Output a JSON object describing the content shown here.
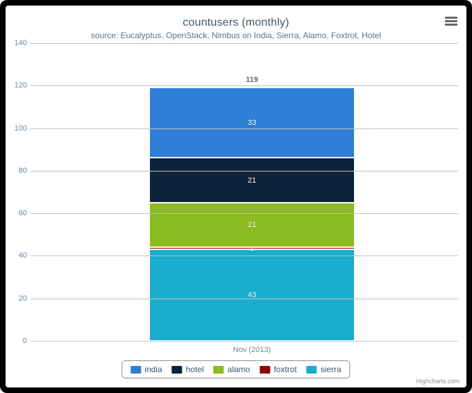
{
  "chart": {
    "title": "countusers (monthly)",
    "subtitle": "source: Eucalyptus, OpenStack, Nimbus on India, Sierra, Alamo, Foxtrot, Hotel",
    "credits": "Highcharts.com",
    "context_menu_icon": "hamburger-icon"
  },
  "chart_data": {
    "type": "bar",
    "stacked": true,
    "title": "countusers (monthly)",
    "subtitle": "source: Eucalyptus, OpenStack, Nimbus on India, Sierra, Alamo, Foxtrot, Hotel",
    "xlabel": "",
    "ylabel": "",
    "categories": [
      "Nov (2013)"
    ],
    "ylim": [
      0,
      140
    ],
    "yticks": [
      0,
      20,
      40,
      60,
      80,
      100,
      120,
      140
    ],
    "grid": true,
    "legend_position": "bottom",
    "stack_totals": [
      119
    ],
    "series": [
      {
        "name": "india",
        "values": [
          33
        ],
        "color": "#2f7ed8"
      },
      {
        "name": "hotel",
        "values": [
          21
        ],
        "color": "#0d233a"
      },
      {
        "name": "alamo",
        "values": [
          21
        ],
        "color": "#8bbc21"
      },
      {
        "name": "foxtrot",
        "values": [
          1
        ],
        "color": "#910000"
      },
      {
        "name": "sierra",
        "values": [
          43
        ],
        "color": "#1aadce"
      }
    ]
  },
  "axis": {
    "y_ticks": [
      {
        "label": "140",
        "value": 140
      },
      {
        "label": "120",
        "value": 120
      },
      {
        "label": "100",
        "value": 100
      },
      {
        "label": "80",
        "value": 80
      },
      {
        "label": "60",
        "value": 60
      },
      {
        "label": "40",
        "value": 40
      },
      {
        "label": "20",
        "value": 20
      },
      {
        "label": "0",
        "value": 0
      }
    ],
    "x_categories": [
      "Nov (2013)"
    ]
  },
  "stack": {
    "total_label": "119",
    "segments": [
      {
        "name": "india",
        "label": "33",
        "value": 33,
        "color": "#2f7ed8"
      },
      {
        "name": "hotel",
        "label": "21",
        "value": 21,
        "color": "#0d233a"
      },
      {
        "name": "alamo",
        "label": "21",
        "value": 21,
        "color": "#8bbc21"
      },
      {
        "name": "foxtrot",
        "label": "1",
        "value": 1,
        "color": "#910000"
      },
      {
        "name": "sierra",
        "label": "43",
        "value": 43,
        "color": "#1aadce"
      }
    ]
  },
  "legend": {
    "items": [
      {
        "label": "india",
        "color": "#2f7ed8"
      },
      {
        "label": "hotel",
        "color": "#0d233a"
      },
      {
        "label": "alamo",
        "color": "#8bbc21"
      },
      {
        "label": "foxtrot",
        "color": "#910000"
      },
      {
        "label": "sierra",
        "color": "#1aadce"
      }
    ]
  }
}
